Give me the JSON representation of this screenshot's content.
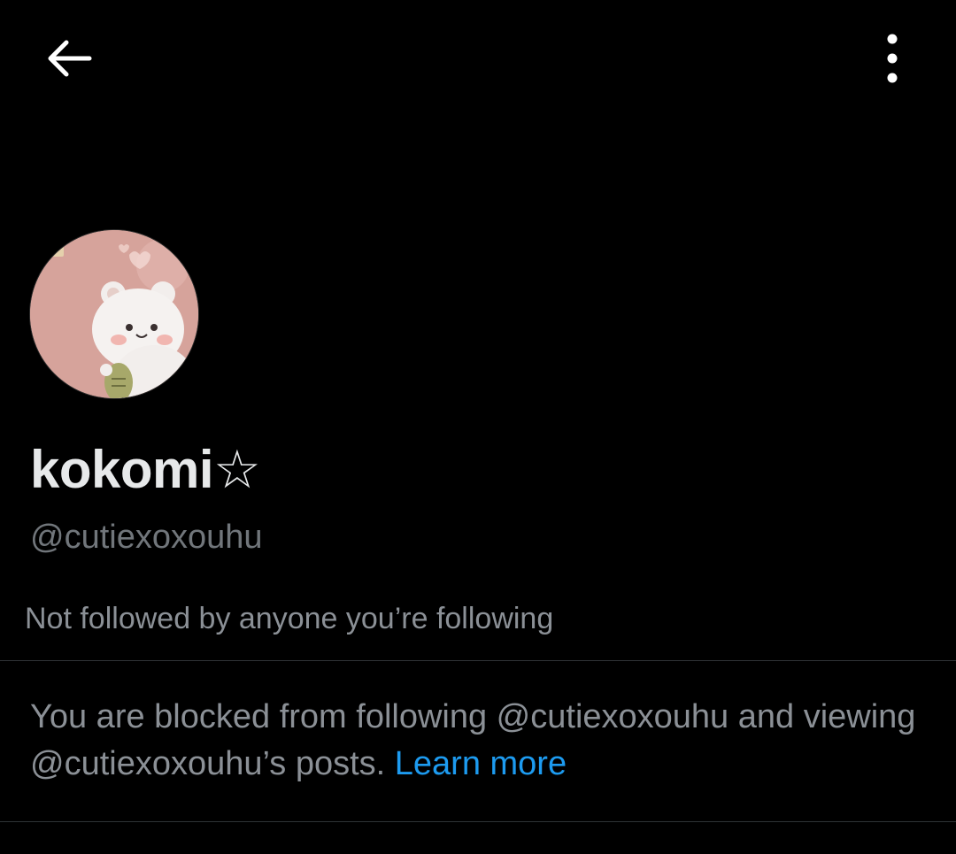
{
  "topbar": {
    "back_icon": "arrow-left-icon",
    "more_icon": "more-vertical-icon"
  },
  "profile": {
    "avatar_icon": "avatar-bear-image",
    "display_name": "kokomi☆",
    "handle": "@cutiexoxouhu",
    "followed_by_text": "Not followed by anyone you’re following"
  },
  "blocked_notice": {
    "text": "You are blocked from following @cutiexoxouhu and viewing @cutiexoxouhu’s posts. ",
    "learn_more_label": "Learn more"
  },
  "colors": {
    "background": "#000000",
    "primary_text": "#e7e9ea",
    "secondary_text": "#71767b",
    "link": "#1d9bf0",
    "divider": "#2f3336"
  }
}
